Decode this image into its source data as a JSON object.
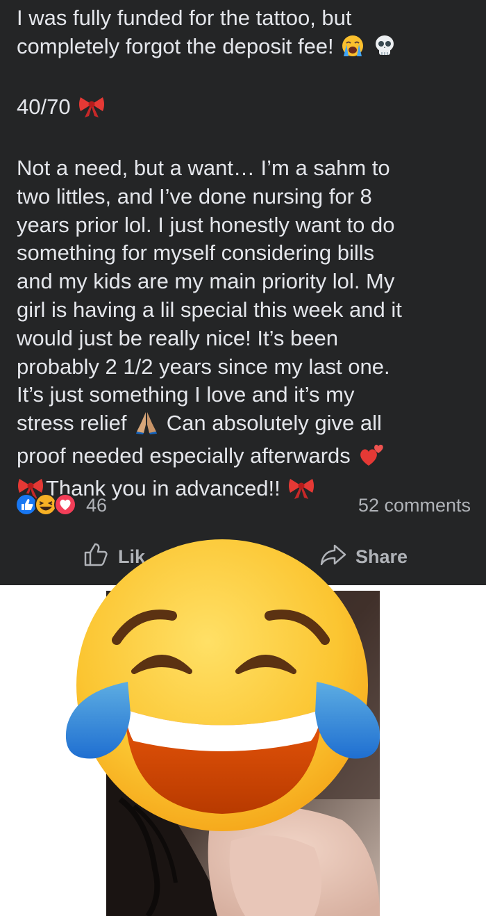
{
  "post": {
    "lines_1": [
      "I was fully funded for the tattoo, but",
      "completely forgot the deposit fee!"
    ],
    "progress": "40/70",
    "body_lines": [
      "Not a need, but a want… I’m a sahm to",
      "two littles, and I’ve done nursing for 8",
      "years prior lol. I just honestly want to do",
      "something for myself considering bills",
      "and my kids are my main priority lol. My",
      "girl is having a lil special this week and it",
      "would just be really nice! It’s been",
      "probably 2 1/2 years since my last one.",
      "It’s just something I love and it’s my",
      "stress relief",
      "Can absolutely give all",
      "proof needed especially afterwards",
      "Thank you in advanced!!"
    ],
    "emojis": {
      "crying": "😭",
      "skull": "💀",
      "bow": "🎀",
      "pray": "🙏",
      "hearts": "💕"
    }
  },
  "reactions": {
    "icons": [
      "like-icon",
      "laugh-icon",
      "love-icon"
    ],
    "count": "46",
    "comments": "52 comments"
  },
  "actions": {
    "like_label": "Lik",
    "share_label": "Share"
  },
  "colors": {
    "card_bg": "#242526",
    "text": "#e4e6eb",
    "muted": "#b0b3b8",
    "like_blue": "#1877f2",
    "love_red": "#f33e58"
  }
}
